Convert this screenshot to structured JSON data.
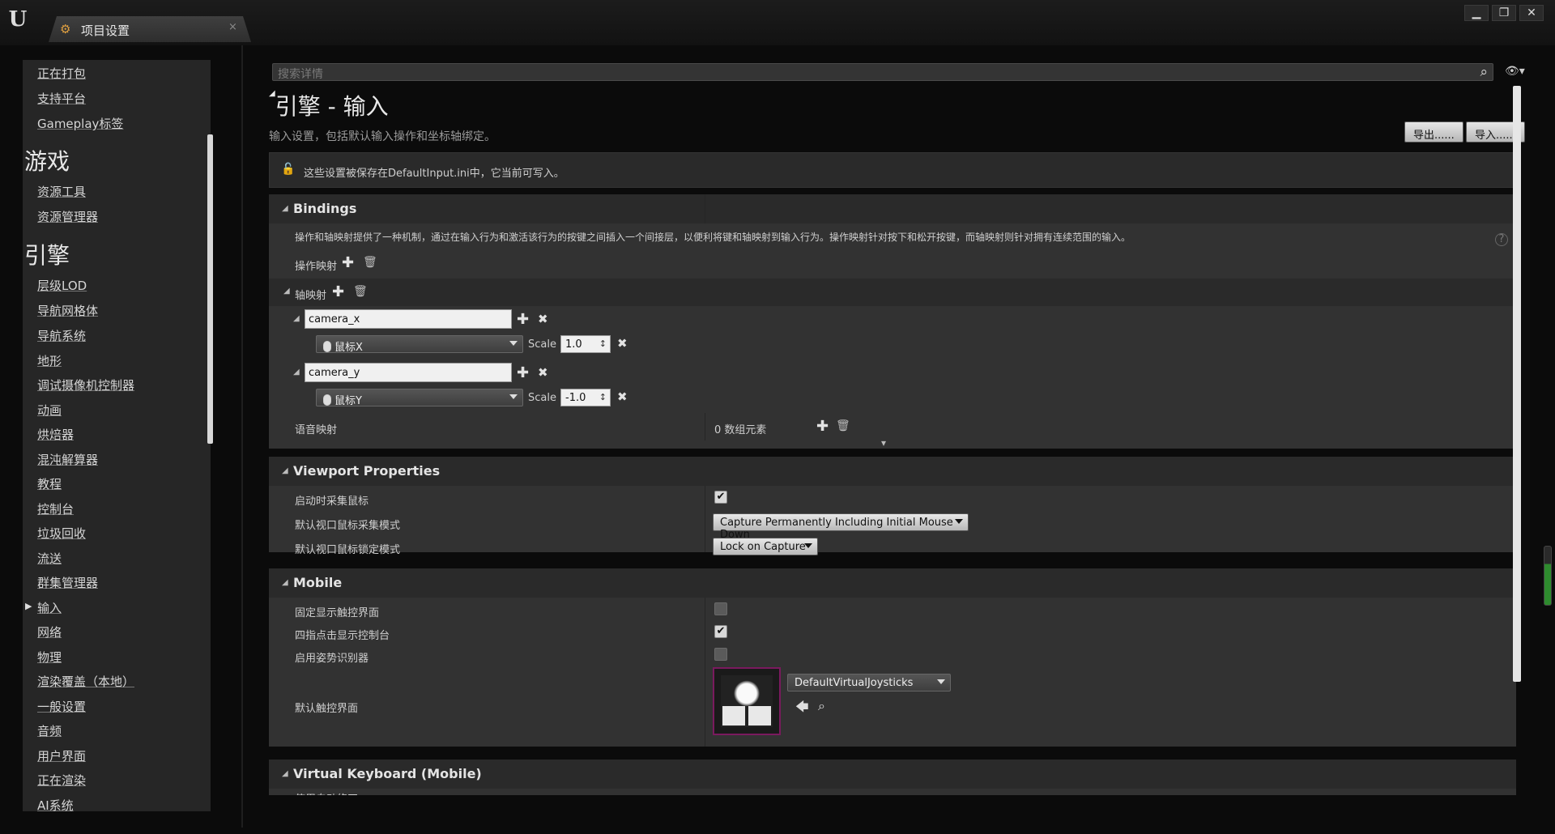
{
  "window": {
    "logo": "U",
    "tab_label": "项目设置",
    "tab_close": "×",
    "controls": [
      "▁",
      "❐",
      "✕"
    ]
  },
  "nav": {
    "items_top": [
      "正在打包",
      "支持平台",
      "Gameplay标签"
    ],
    "cat_game": "游戏",
    "items_game": [
      "资源工具",
      "资源管理器"
    ],
    "cat_engine": "引擎",
    "items_engine": [
      "层级LOD",
      "导航网格体",
      "导航系统",
      "地形",
      "调试摄像机控制器",
      "动画",
      "烘焙器",
      "混沌解算器",
      "教程",
      "控制台",
      "垃圾回收",
      "流送",
      "群集管理器",
      "输入",
      "网络",
      "物理",
      "渲染覆盖（本地）",
      "一般设置",
      "音频",
      "用户界面",
      "正在渲染",
      "AI系统"
    ],
    "active_item": "输入"
  },
  "search": {
    "placeholder": "搜索详情"
  },
  "header": {
    "title": "引擎 - 输入",
    "description": "输入设置，包括默认输入操作和坐标轴绑定。",
    "export_label": "导出......",
    "import_label": "导入......"
  },
  "info": {
    "text": "这些设置被保存在DefaultInput.ini中，它当前可写入。"
  },
  "bindings": {
    "title": "Bindings",
    "description": "操作和轴映射提供了一种机制，通过在输入行为和激活该行为的按键之间插入一个间接层，以便利将键和轴映射到输入行为。操作映射针对按下和松开按键，而轴映射则针对拥有连续范围的输入。",
    "action_label": "操作映射",
    "axis_label": "轴映射",
    "axes": [
      {
        "name": "camera_x",
        "key": "鼠标X",
        "scale_label": "Scale",
        "scale": "1.0"
      },
      {
        "name": "camera_y",
        "key": "鼠标Y",
        "scale_label": "Scale",
        "scale": "-1.0"
      }
    ],
    "speech_label": "语音映射",
    "speech_value": "0 数组元素"
  },
  "viewport": {
    "title": "Viewport Properties",
    "rows": [
      {
        "label": "启动时采集鼠标",
        "checked": true
      },
      {
        "label": "默认视口鼠标采集模式",
        "value": "Capture Permanently Including Initial Mouse Down"
      },
      {
        "label": "默认视口鼠标锁定模式",
        "value": "Lock on Capture"
      }
    ]
  },
  "mobile": {
    "title": "Mobile",
    "rows": [
      {
        "label": "固定显示触控界面",
        "checked": false
      },
      {
        "label": "四指点击显示控制台",
        "checked": true
      },
      {
        "label": "启用姿势识别器",
        "checked": false
      }
    ],
    "touch_label": "默认触控界面",
    "touch_value": "DefaultVirtualJoysticks"
  },
  "vkeyboard": {
    "title": "Virtual Keyboard (Mobile)",
    "rows": [
      {
        "label": "使用自动修正",
        "checked": false
      }
    ]
  },
  "icons": {
    "plus": "✚",
    "trash": "🗑",
    "x": "✖",
    "search": "⌕",
    "eye": "👁▾",
    "lock": "🔓",
    "back": "🡄",
    "browse": "⌕",
    "help": "?",
    "scale_arrow": "↕",
    "expand": "▾",
    "check_on": "✔",
    "triangle": "◢",
    "arrow_right": "▶"
  },
  "colors": {
    "accent_thumb_border": "#7a1a5e",
    "panel": "#323232",
    "background": "#0b0b0b"
  }
}
